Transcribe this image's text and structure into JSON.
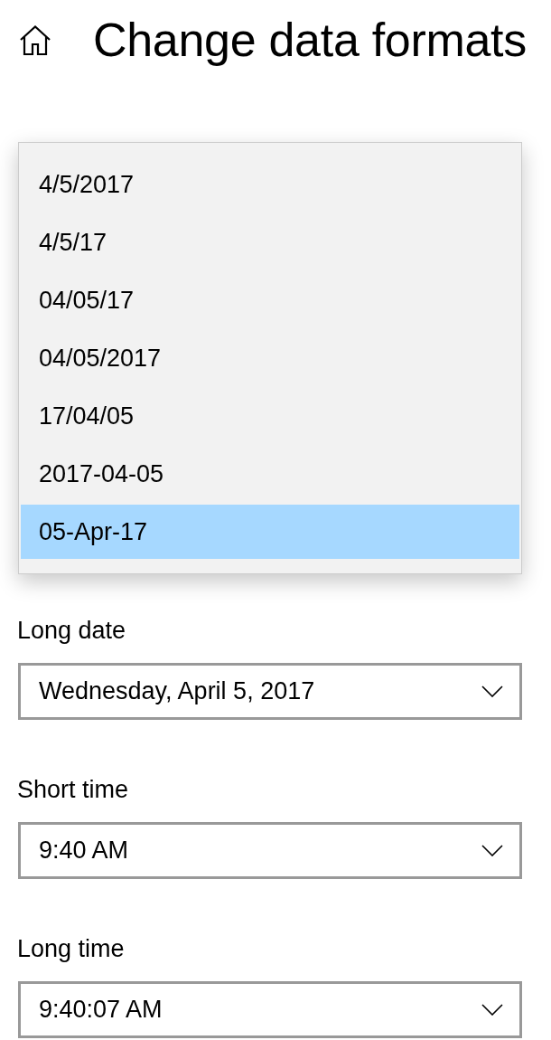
{
  "header": {
    "title": "Change data formats"
  },
  "short_date_menu": {
    "options": [
      {
        "label": "4/5/2017",
        "selected": false
      },
      {
        "label": "4/5/17",
        "selected": false
      },
      {
        "label": "04/05/17",
        "selected": false
      },
      {
        "label": "04/05/2017",
        "selected": false
      },
      {
        "label": "17/04/05",
        "selected": false
      },
      {
        "label": "2017-04-05",
        "selected": false
      },
      {
        "label": "05-Apr-17",
        "selected": true
      }
    ]
  },
  "fields": [
    {
      "label": "Long date",
      "value": "Wednesday, April 5, 2017"
    },
    {
      "label": "Short time",
      "value": "9:40 AM"
    },
    {
      "label": "Long time",
      "value": "9:40:07 AM"
    }
  ]
}
